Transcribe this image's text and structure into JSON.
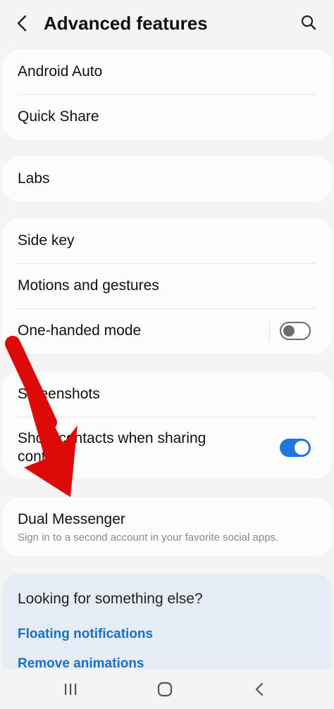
{
  "header": {
    "title": "Advanced features",
    "back_icon": "chevron-left-icon",
    "search_icon": "search-icon"
  },
  "groups": [
    {
      "items": [
        {
          "label": "Android Auto"
        },
        {
          "label": "Quick Share"
        }
      ]
    },
    {
      "items": [
        {
          "label": "Labs"
        }
      ]
    },
    {
      "items": [
        {
          "label": "Side key"
        },
        {
          "label": "Motions and gestures"
        },
        {
          "label": "One-handed mode",
          "toggle": false
        }
      ]
    },
    {
      "items": [
        {
          "label": "Screenshots"
        },
        {
          "label": "Show contacts when sharing content",
          "toggle": true
        }
      ]
    },
    {
      "items": [
        {
          "label": "Dual Messenger",
          "subtitle": "Sign in to a second account in your favorite social apps."
        }
      ]
    }
  ],
  "suggestions": {
    "title": "Looking for something else?",
    "links": [
      "Floating notifications",
      "Remove animations"
    ]
  },
  "navbar": {
    "recents_icon": "recents-icon",
    "home_icon": "home-icon",
    "back_icon": "back-icon"
  },
  "colors": {
    "accent": "#1f76e0",
    "link": "#1a70c8",
    "annotation_arrow": "#dd0a0a"
  }
}
